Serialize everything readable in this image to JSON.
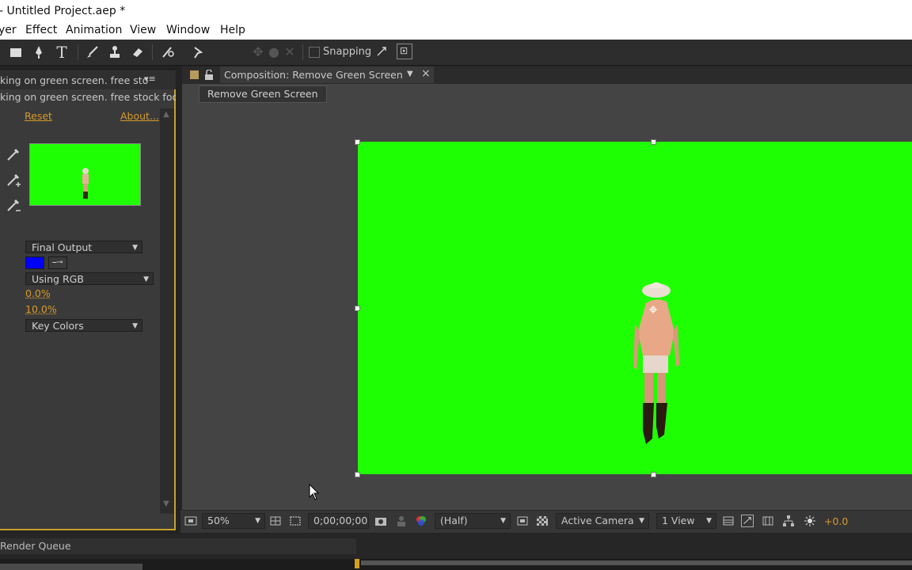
{
  "window": {
    "title": "- Untitled Project.aep *"
  },
  "menu": {
    "items": [
      "yer",
      "Effect",
      "Animation",
      "View",
      "Window",
      "Help"
    ]
  },
  "toolbar": {
    "tools": [
      "rectangle-tool-icon",
      "pen-tool-icon",
      "text-tool-icon",
      "brush-tool-icon",
      "clone-stamp-icon",
      "eraser-icon",
      "roto-brush-icon",
      "puppet-pin-icon"
    ],
    "snapping_label": "Snapping",
    "snapping_checked": false
  },
  "effect_panel": {
    "tab_label": "king on green screen. free sto",
    "layer_label": "king on green screen. free stock foota",
    "reset_label": "Reset",
    "about_label": "About...",
    "view_dropdown": "Final Output",
    "screen_color": "#0000ff",
    "color_mode_dropdown": "Using RGB",
    "value_1": "0.0%",
    "value_2": "10.0%",
    "output_dropdown": "Key Colors"
  },
  "composition": {
    "tab_label": "Composition: Remove Green Screen",
    "breadcrumb": "Remove Green Screen",
    "background_color": "#1fff03"
  },
  "comp_footer": {
    "zoom": "50%",
    "timecode": "0;00;00;00",
    "resolution": "(Half)",
    "camera": "Active Camera",
    "view_layout": "1 View",
    "exposure": "+0.0"
  },
  "footer": {
    "tab_label": "Render Queue"
  }
}
